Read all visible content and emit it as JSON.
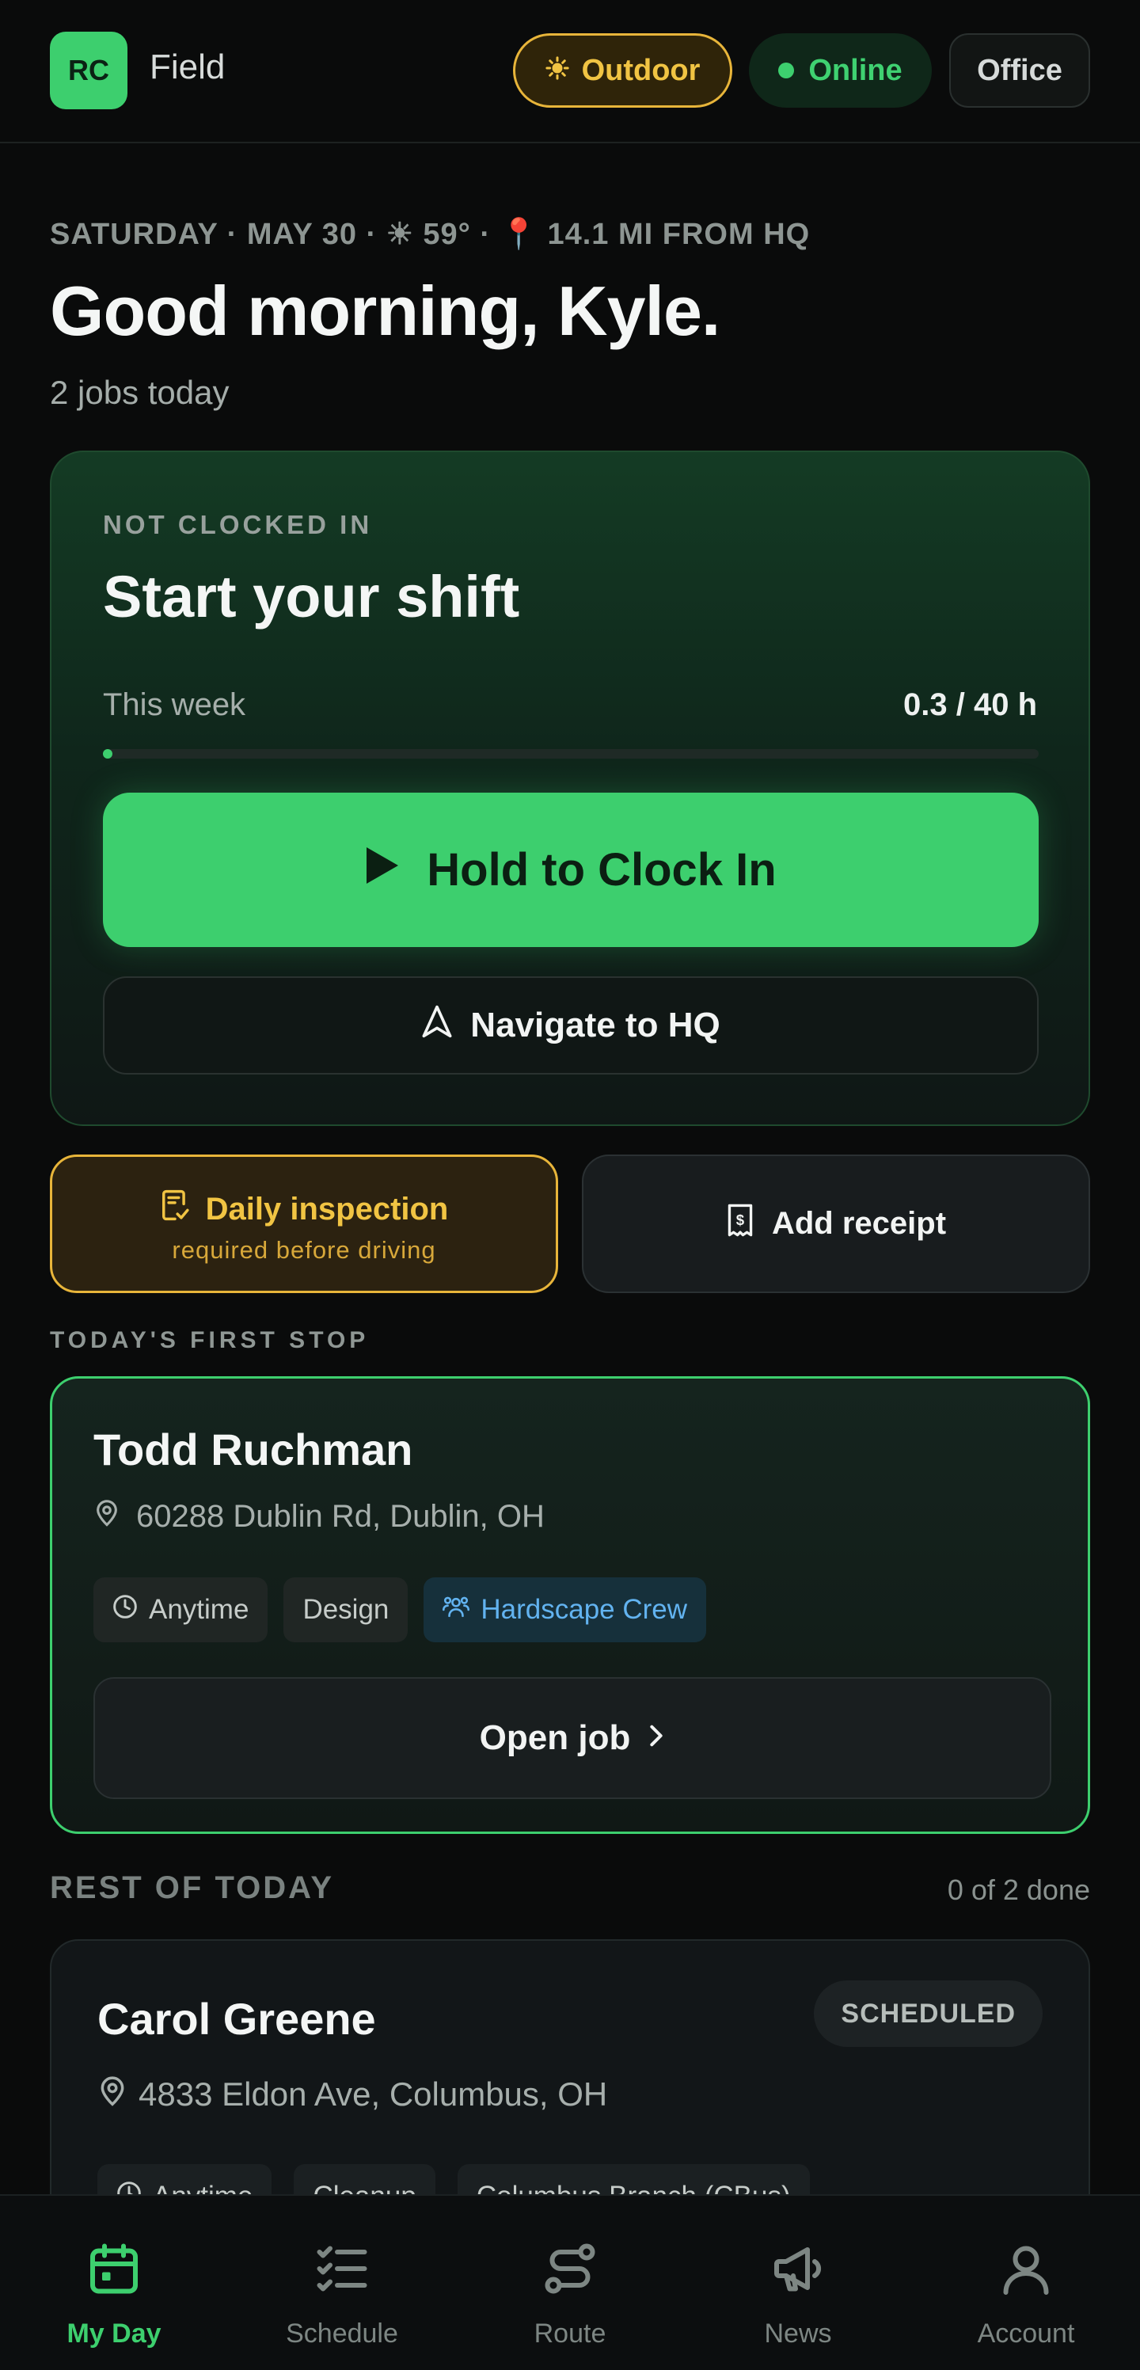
{
  "header": {
    "logo_initials": "RC",
    "app_name": "Field",
    "mode_label": "Outdoor",
    "status_label": "Online",
    "office_label": "Office"
  },
  "greeting": {
    "dateline": "SATURDAY · MAY 30 · ☀ 59° · 📍 14.1 MI FROM HQ",
    "headline": "Good morning, Kyle.",
    "jobs_count": "2 jobs today"
  },
  "shift": {
    "status": "NOT CLOCKED IN",
    "title": "Start your shift",
    "week_label": "This week",
    "week_value": "0.3 / 40 h",
    "week_progress_fraction": 0.0075,
    "clock_in_label": "Hold to Clock In",
    "navigate_label": "Navigate to HQ"
  },
  "actions": {
    "inspection_title": "Daily inspection",
    "inspection_subtitle": "required before driving",
    "receipt_label": "Add receipt"
  },
  "first_stop": {
    "section_label": "TODAY'S FIRST STOP",
    "customer": "Todd Ruchman",
    "address": "60288 Dublin Rd, Dublin, OH",
    "chips": [
      "Anytime",
      "Design",
      "Hardscape Crew"
    ],
    "open_label": "Open job"
  },
  "rest_of_today": {
    "section_label": "REST OF TODAY",
    "progress": "0 of 2 done",
    "jobs": [
      {
        "customer": "Carol Greene",
        "status": "SCHEDULED",
        "address": "4833 Eldon Ave, Columbus, OH",
        "chips": [
          "Anytime",
          "Cleanup",
          "Columbus Branch (CBus)"
        ]
      }
    ]
  },
  "bottom_nav": {
    "items": [
      {
        "label": "My Day",
        "icon": "calendar-icon",
        "active": true
      },
      {
        "label": "Schedule",
        "icon": "checklist-icon",
        "active": false
      },
      {
        "label": "Route",
        "icon": "route-icon",
        "active": false
      },
      {
        "label": "News",
        "icon": "megaphone-icon",
        "active": false
      },
      {
        "label": "Account",
        "icon": "user-icon",
        "active": false
      }
    ]
  },
  "colors": {
    "accent_green": "#3dcf6e",
    "warning_amber": "#e8b53a",
    "crew_blue": "#62b3f0",
    "background": "#0a0b0b"
  }
}
